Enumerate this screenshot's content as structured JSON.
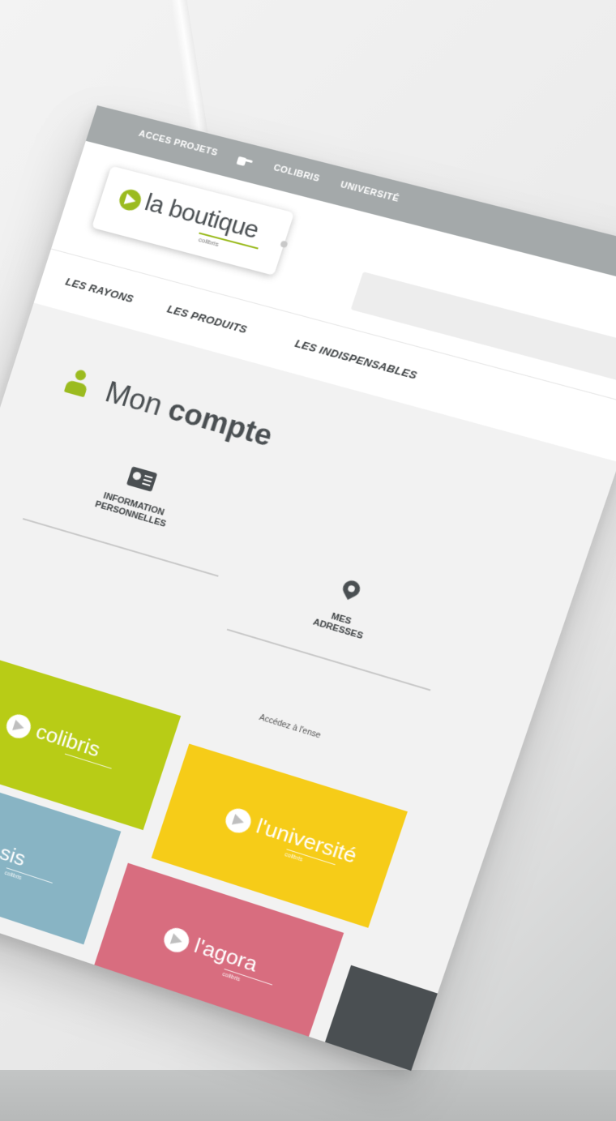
{
  "topbar": {
    "items": [
      "ACCES PROJETS",
      "COLIBRIS",
      "UNIVERSITÉ"
    ]
  },
  "logo": {
    "name": "la boutique",
    "sub": "colibris"
  },
  "mainnav": {
    "items": [
      "LES RAYONS",
      "LES PRODUITS",
      "LES INDISPENSABLES"
    ]
  },
  "account": {
    "title_light": "Mon",
    "title_bold": "compte",
    "tiles": [
      {
        "line1": "INFORMATION",
        "line2": "PERSONNELLES",
        "icon": "id-card-icon"
      },
      {
        "line1": "MES",
        "line2": "ADRESSES",
        "icon": "map-pin-icon"
      }
    ]
  },
  "access_text": "Accédez à l'ense",
  "brands": [
    {
      "name": "colibris",
      "sub": "",
      "color": "#b8cc16"
    },
    {
      "name": "l'université",
      "sub": "colibris",
      "color": "#f6cc18"
    },
    {
      "name": "oasis",
      "sub": "colibris",
      "color": "#88b4c4"
    },
    {
      "name": "l'agora",
      "sub": "colibris",
      "color": "#d86d7f"
    }
  ],
  "colors": {
    "accent": "#9bbb1f",
    "topbar": "#a4a9aa",
    "text": "#3b3f41"
  }
}
